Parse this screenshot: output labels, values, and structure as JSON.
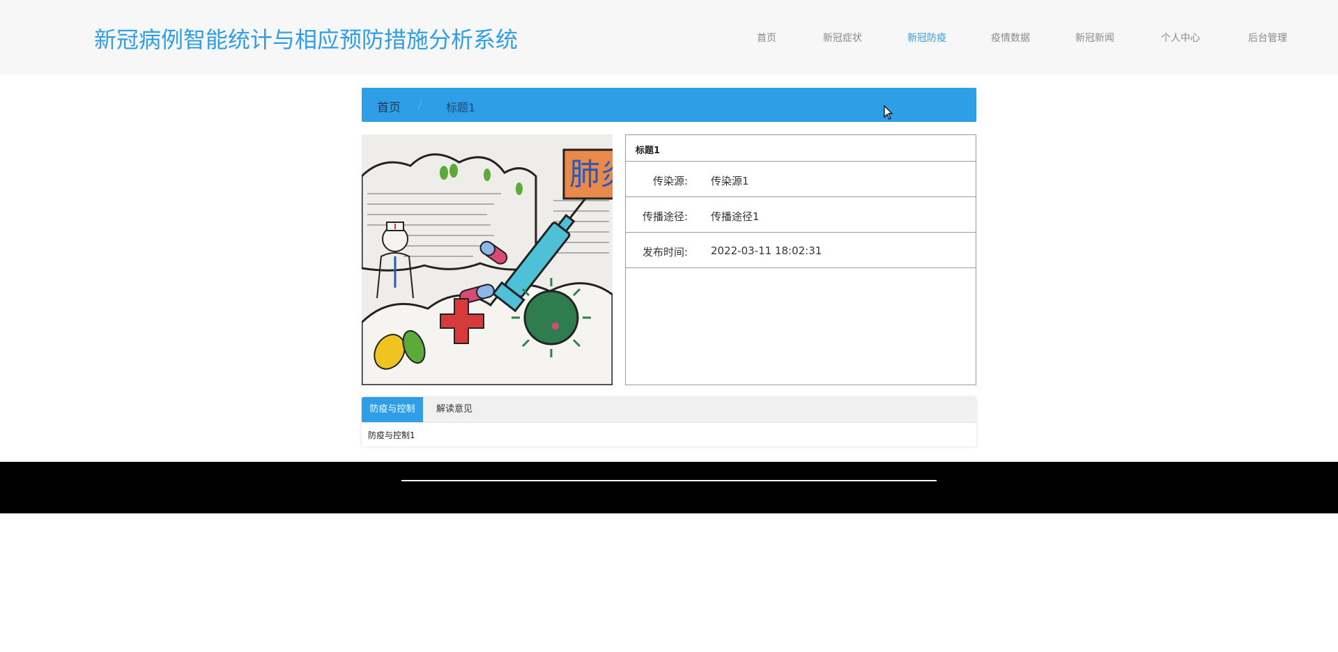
{
  "header": {
    "title": "新冠病例智能统计与相应预防措施分析系统",
    "nav": [
      "首页",
      "新冠症状",
      "新冠防疫",
      "疫情数据",
      "新冠新闻",
      "个人中心",
      "后台管理"
    ],
    "active_nav": "新冠防疫"
  },
  "breadcrumb": {
    "home": "首页",
    "separator": "/",
    "current": "标题1"
  },
  "detail": {
    "title": "标题1",
    "rows": [
      {
        "label": "传染源:",
        "value": "传染源1"
      },
      {
        "label": "传播途径:",
        "value": "传播途径1"
      },
      {
        "label": "发布时间:",
        "value": "2022-03-11 18:02:31"
      }
    ]
  },
  "image": {
    "headline_glyphs": "肺炎",
    "description": "hand-drawn poster with doctor, syringe, pills, red cross and virus"
  },
  "tabs": {
    "items": [
      "防疫与控制",
      "解读意见"
    ],
    "active": "防疫与控制",
    "content": "防疫与控制1"
  },
  "colors": {
    "accent": "#2e9ee6",
    "header_bg": "#f7f7f7",
    "footer_bg": "#000000"
  }
}
